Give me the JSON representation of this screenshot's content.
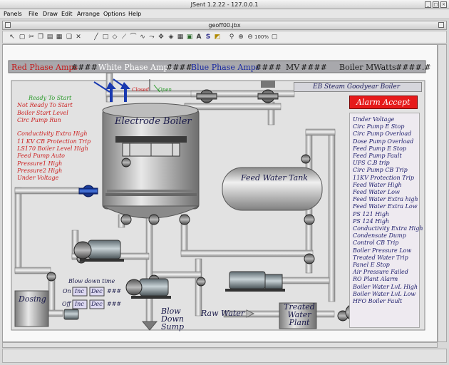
{
  "window": {
    "title": "JSent 1.2.22 - 127.0.0.1",
    "document_title": "geoff00.jbx",
    "status_text": ""
  },
  "menu": [
    "Panels",
    "File",
    "Draw",
    "Edit",
    "Arrange",
    "Options",
    "Help"
  ],
  "toolbar": {
    "zoom_label": "100%",
    "tools": [
      "select-icon",
      "new-icon",
      "cut-icon",
      "copy-icon",
      "paste-icon",
      "delete-icon",
      "line-icon",
      "polyline-icon",
      "rectangle-icon",
      "arc-icon",
      "curve-icon",
      "spline-icon",
      "move-icon",
      "grid-icon",
      "image-icon",
      "text-icon",
      "symbol-icon",
      "zoom-in-icon",
      "zoom-out-icon",
      "zoom-reset-icon",
      "fit-icon"
    ]
  },
  "header": {
    "red_phase": "Red Phase Amps",
    "red_value": "####",
    "white_phase": "White Phase Amps",
    "white_value": "####",
    "blue_phase": "Blue Phase Amps",
    "blue_value": "####",
    "mv_label": "MV",
    "mv_value": "####",
    "boiler_mwatts": "Boiler MWatts",
    "boiler_value": "####.#"
  },
  "panel": {
    "title": "EB Steam Goodyear Boiler",
    "alarm_accept": "Alarm Accept"
  },
  "boiler_states": [
    {
      "text": "Ready To Start",
      "color": "#2a9a2a"
    },
    {
      "text": "Not Ready To Start",
      "color": "#cc2020"
    },
    {
      "text": "Boiler Start Level",
      "color": "#cc2020"
    },
    {
      "text": "Circ Pump Run",
      "color": "#cc2020"
    },
    {
      "text": "Conductivity Extra High",
      "color": "#cc2020"
    },
    {
      "text": "11 KV  CB Protection Trip",
      "color": "#cc2020"
    },
    {
      "text": "LS170 Boiler Level High",
      "color": "#cc2020"
    },
    {
      "text": "Feed Pump Auto",
      "color": "#cc2020"
    },
    {
      "text": "Pressure1 High",
      "color": "#cc2020"
    },
    {
      "text": "Pressure2 High",
      "color": "#cc2020"
    },
    {
      "text": "Under Voltage",
      "color": "#cc2020"
    }
  ],
  "valve": {
    "closed": "Closed",
    "open": "Open"
  },
  "equipment": {
    "boiler": "Electrode Boiler",
    "feed_tank": "Feed Water Tank",
    "dosing": "Dosing",
    "blow_down_time": "Blow down time",
    "on": "On",
    "off": "Off",
    "inc": "Inc",
    "dec": "Dec",
    "hashes": "###",
    "blow_down_sump": "Blow Down Sump",
    "raw_water": "Raw Water",
    "treated_water_plant": "Treated Water Plant"
  },
  "alarms": [
    "Under Voltage",
    "Circ Pump E Stop",
    "Circ Pump Overload",
    "Dose Pump Overload",
    "Feed Pump E Stop",
    "Feed Pump Fault",
    "UPS C.B trip",
    "Circ Pump CB Trip",
    "11KV Protection Trip",
    "Feed Water High",
    "Feed Water Low",
    "Feed Water Extra high",
    "Feed Water Extra Low",
    "PS 121 High",
    "PS 124 High",
    "Conductivity Extra High",
    "Condensate Dump",
    "Control CB Trip",
    "Boiler Pressure Low",
    "Treated Water  Trip",
    "Panel E Stop",
    "Air Pressure Failed",
    "RO Plant Alarm",
    "Boiler Water LvL High",
    "Boiler Water LvL Low",
    "HFO Boiler Fault"
  ]
}
